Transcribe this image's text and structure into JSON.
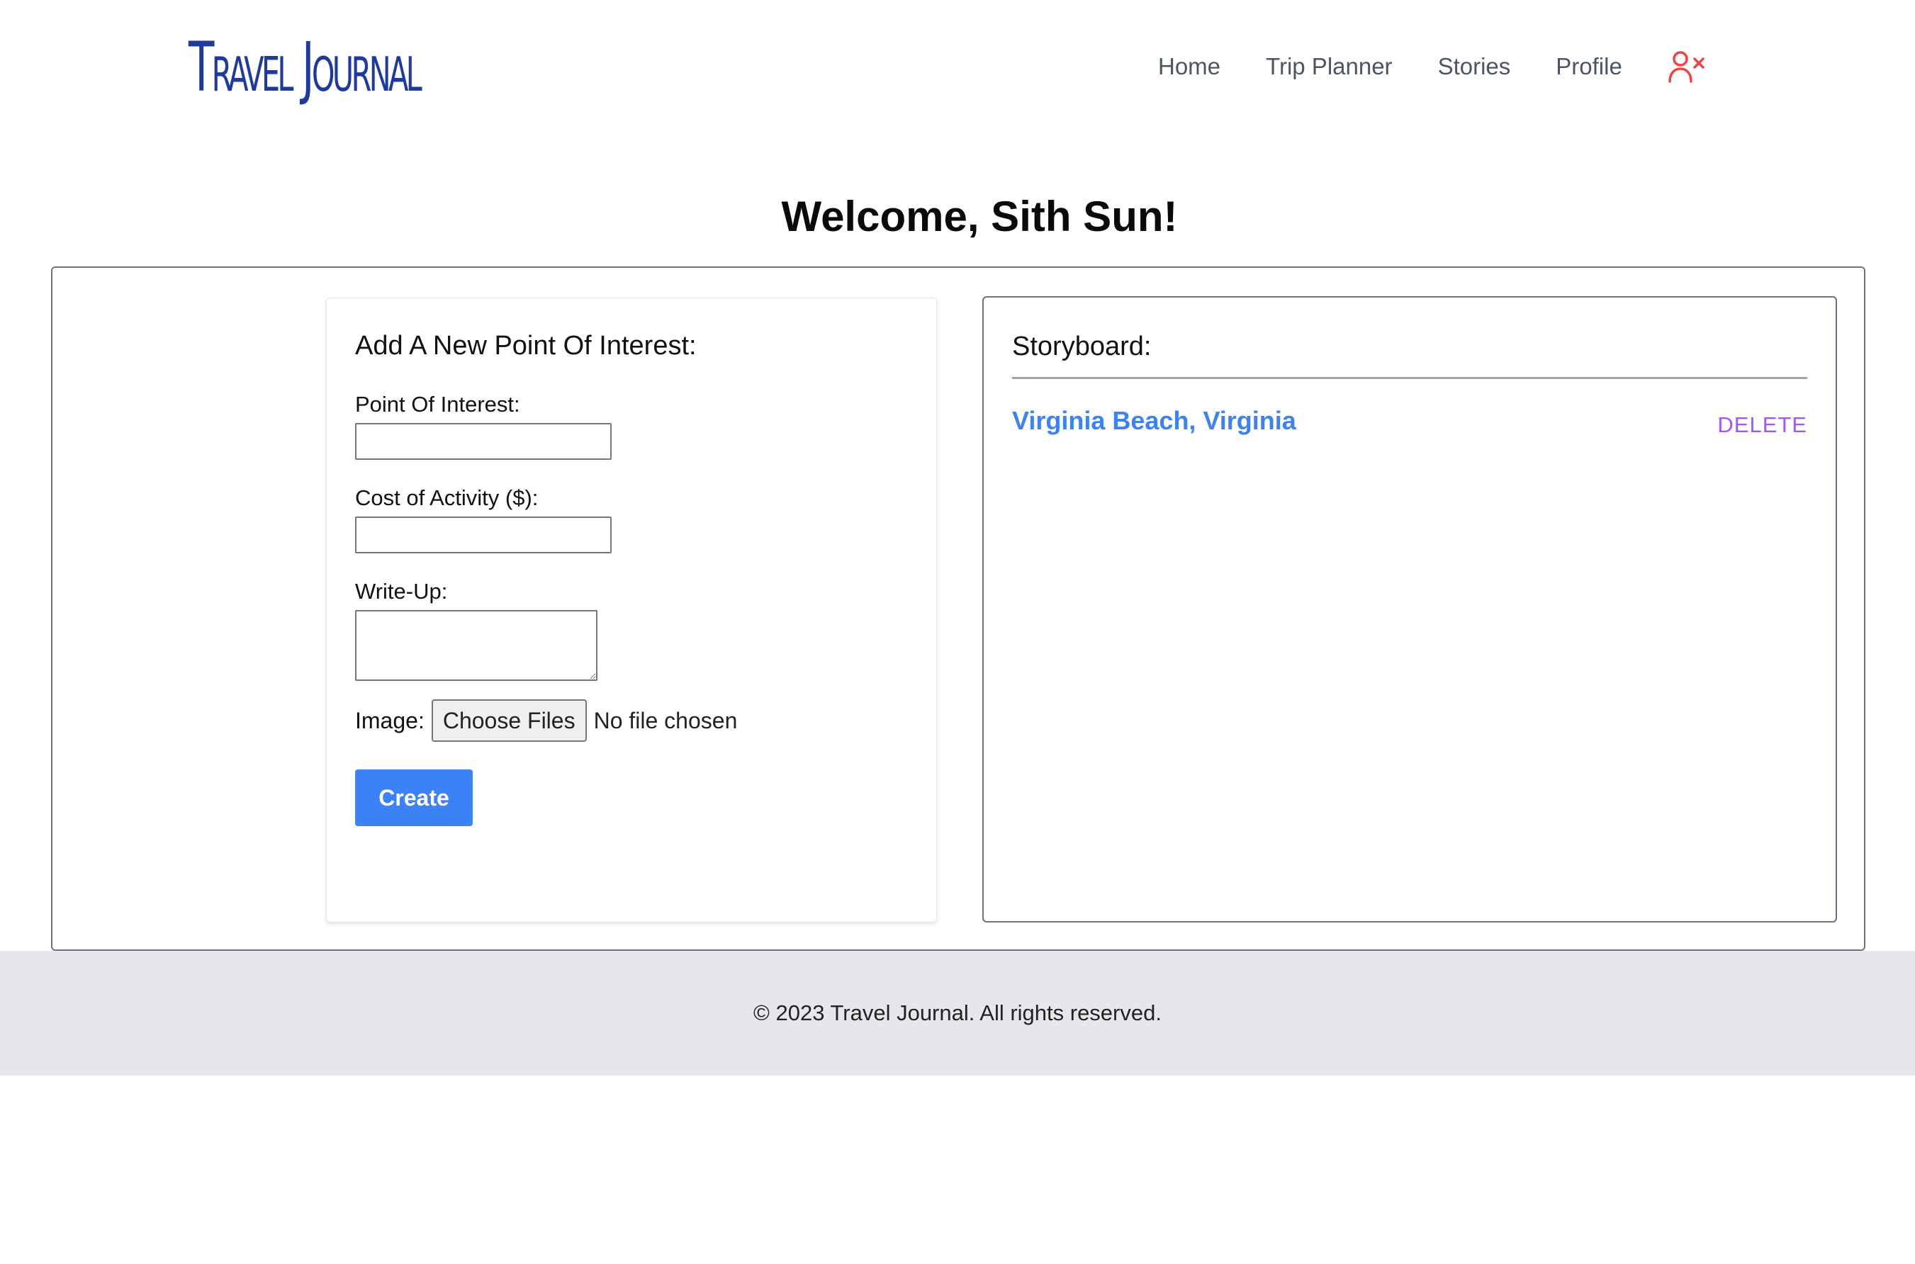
{
  "header": {
    "logo": "Travel Journal",
    "nav": {
      "home": "Home",
      "trip_planner": "Trip Planner",
      "stories": "Stories",
      "profile": "Profile"
    },
    "logout_icon": "user-x-icon",
    "logout_color": "#ef4444"
  },
  "welcome": "Welcome, Sith Sun!",
  "form": {
    "title": "Add A New Point Of Interest:",
    "poi_label": "Point Of Interest:",
    "poi_value": "",
    "cost_label": "Cost of Activity ($):",
    "cost_value": "",
    "writeup_label": "Write-Up:",
    "writeup_value": "",
    "image_label": "Image:",
    "file_button": "Choose Files",
    "file_status": "No file chosen",
    "create_button": "Create"
  },
  "storyboard": {
    "title": "Storyboard:",
    "items": [
      {
        "name": "Virginia Beach, Virginia",
        "delete_label": "DELETE"
      }
    ]
  },
  "footer": {
    "text": "© 2023 Travel Journal. All rights reserved."
  },
  "colors": {
    "brand": "#1e3a9e",
    "accent": "#3b82f6",
    "delete": "#a855f7",
    "footer_bg": "#e5e7eb"
  }
}
